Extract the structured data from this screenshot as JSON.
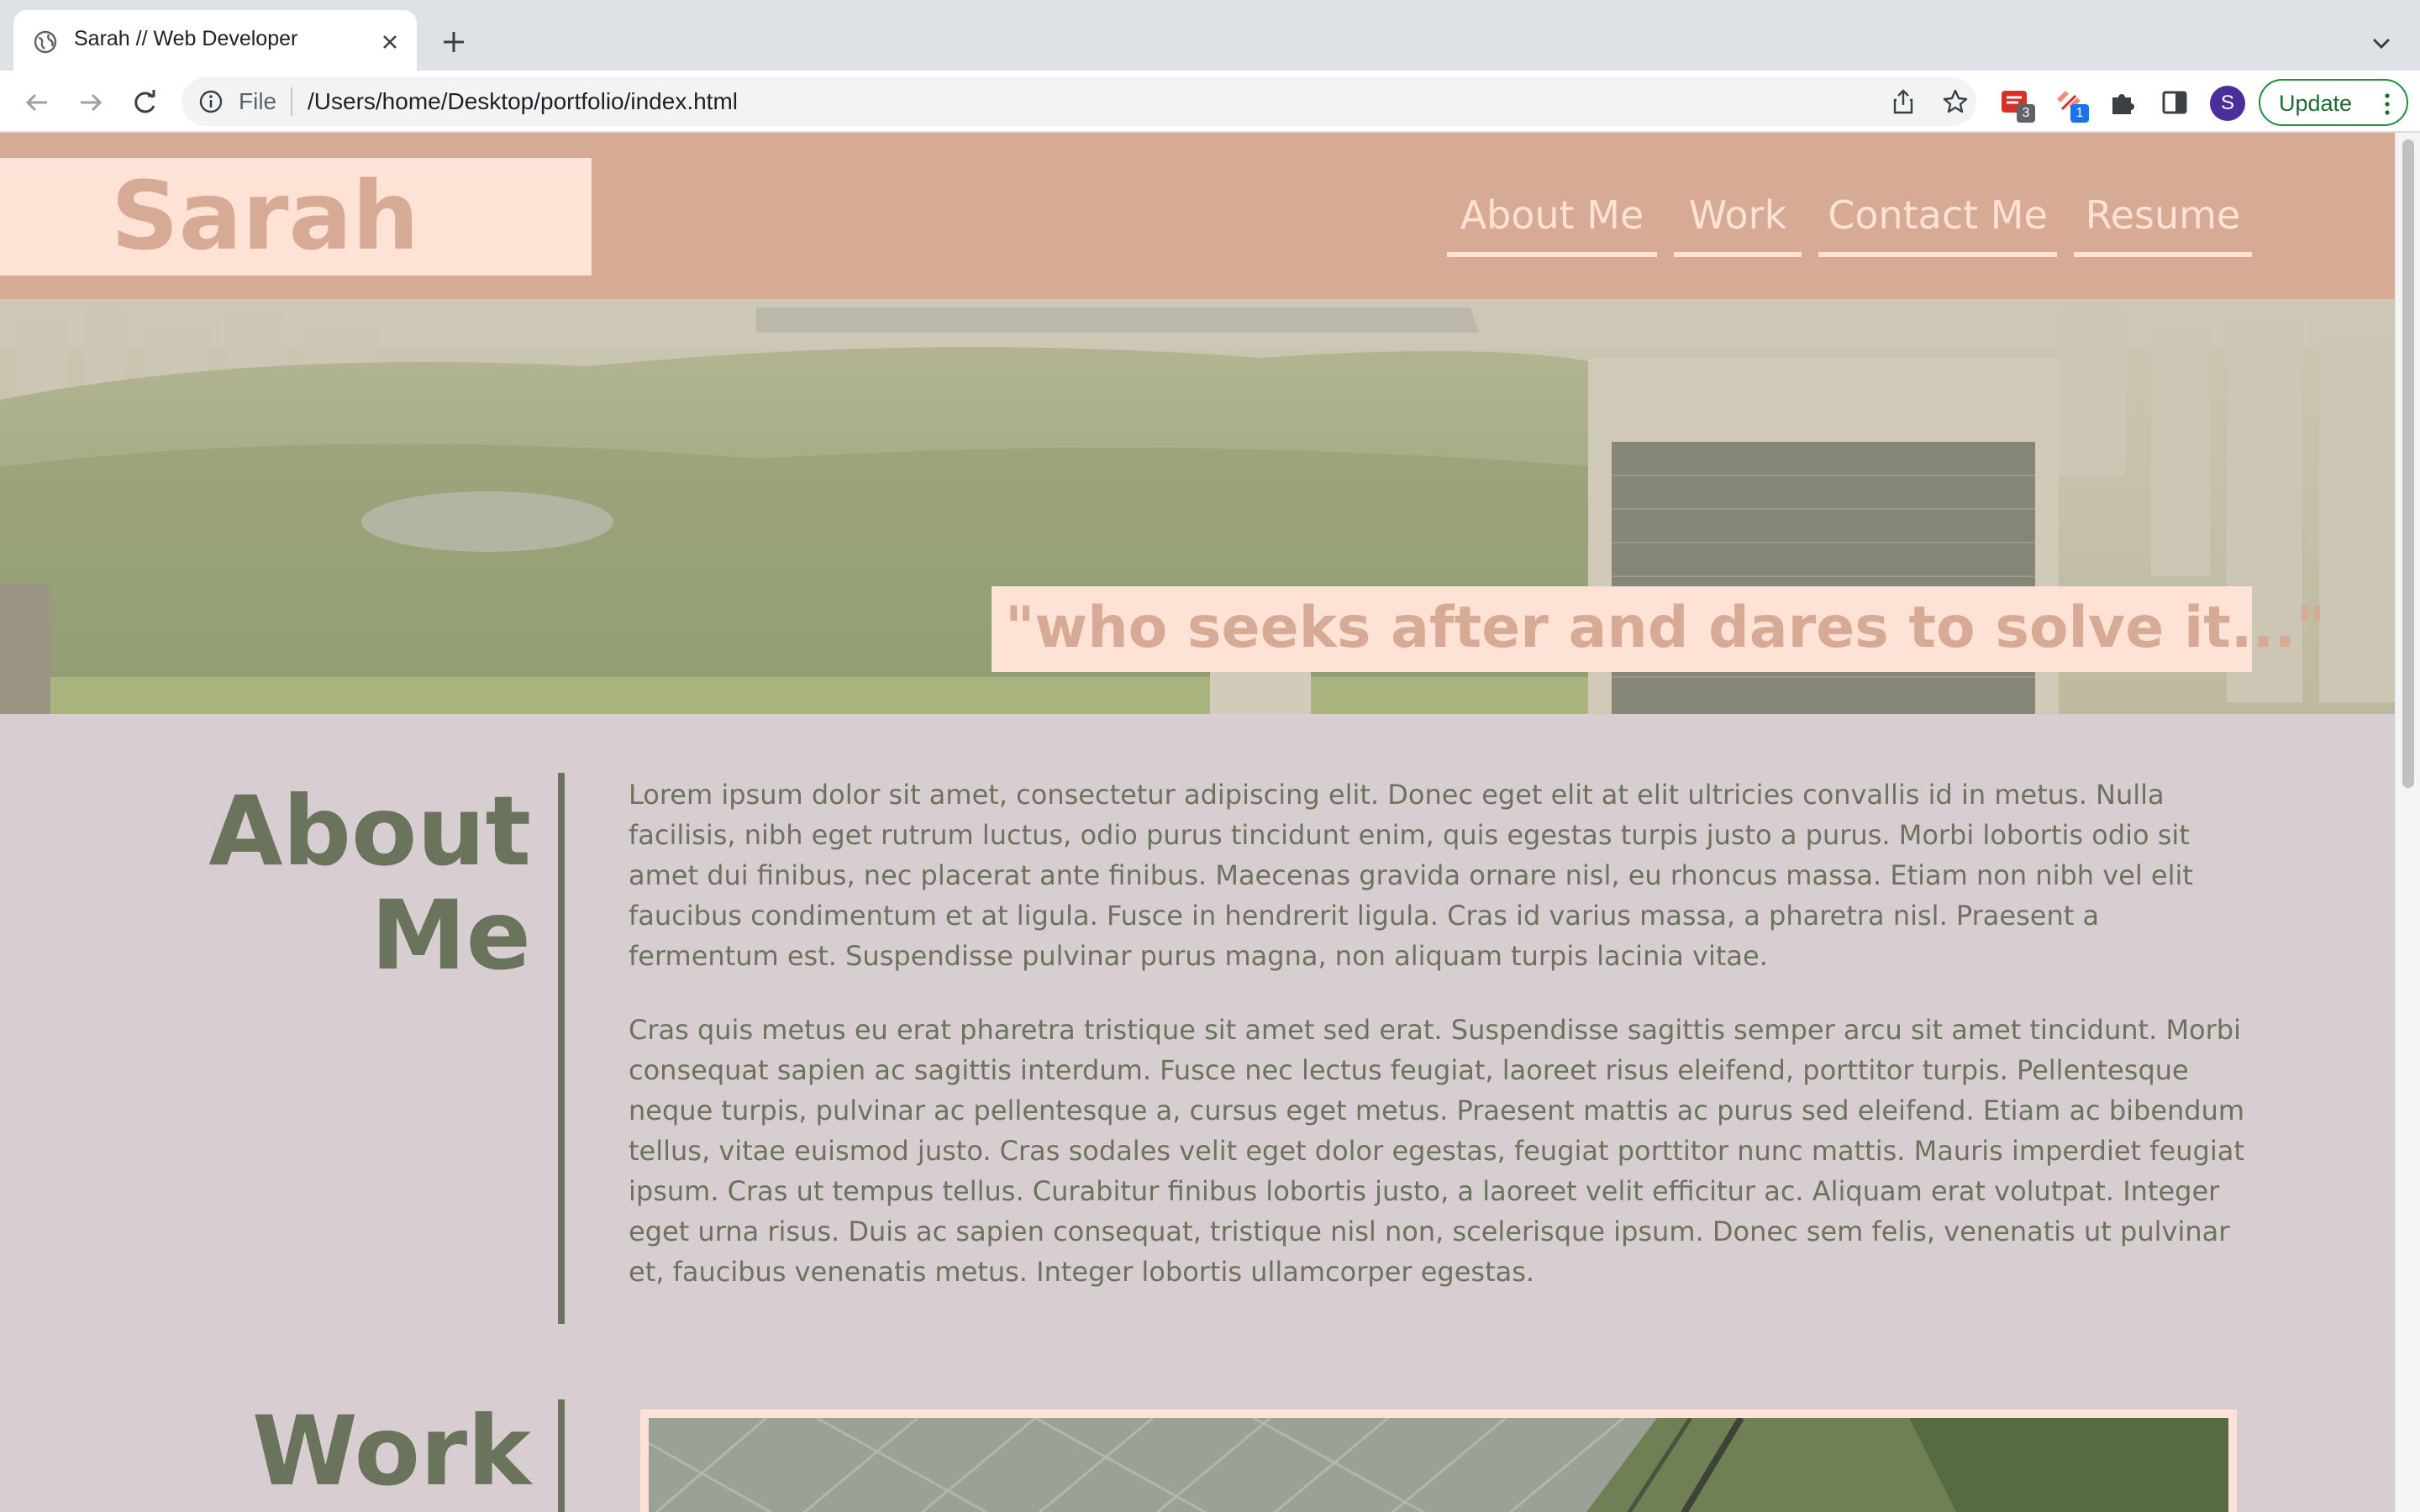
{
  "browser": {
    "tab_title": "Sarah // Web Developer",
    "omnibox_scheme": "File",
    "url": "/Users/home/Desktop/portfolio/index.html",
    "extensions": [
      {
        "name": "ext-red-icon",
        "badge": "3",
        "badge_color": "#5f6368"
      },
      {
        "name": "ext-pink-icon",
        "badge": "1",
        "badge_color": "#1a73e8"
      }
    ],
    "profile_initial": "S",
    "update_label": "Update"
  },
  "site": {
    "brand": "Sarah",
    "nav": [
      {
        "label": "About Me"
      },
      {
        "label": "Work"
      },
      {
        "label": "Contact Me"
      },
      {
        "label": "Resume"
      }
    ],
    "hero_quote": "\"who seeks after and dares to solve it...\"",
    "about": {
      "title_line1": "About",
      "title_line2": "Me",
      "paragraphs": [
        "Lorem ipsum dolor sit amet, consectetur adipiscing elit. Donec eget elit at elit ultricies convallis id in metus. Nulla facilisis, nibh eget rutrum luctus, odio purus tincidunt enim, quis egestas turpis justo a purus. Morbi lobortis odio sit amet dui finibus, nec placerat ante finibus. Maecenas gravida ornare nisl, eu rhoncus massa. Etiam non nibh vel elit faucibus condimentum et at ligula. Fusce in hendrerit ligula. Cras id varius massa, a pharetra nisl. Praesent a fermentum est. Suspendisse pulvinar purus magna, non aliquam turpis lacinia vitae.",
        "Cras quis metus eu erat pharetra tristique sit amet sed erat. Suspendisse sagittis semper arcu sit amet tincidunt. Morbi consequat sapien ac sagittis interdum. Fusce nec lectus feugiat, laoreet risus eleifend, porttitor turpis. Pellentesque neque turpis, pulvinar ac pellentesque a, cursus eget metus. Praesent mattis ac purus sed eleifend. Etiam ac bibendum tellus, vitae euismod justo. Cras sodales velit eget dolor egestas, feugiat porttitor nunc mattis. Mauris imperdiet feugiat ipsum. Cras ut tempus tellus. Curabitur finibus lobortis justo, a laoreet velit efficitur ac. Aliquam erat volutpat. Integer eget urna risus. Duis ac sapien consequat, tristique nisl non, scelerisque ipsum. Donec sem felis, venenatis ut pulvinar et, faucibus venenatis metus. Integer lobortis ullamcorper egestas."
      ]
    },
    "work": {
      "title": "Work"
    }
  },
  "colors": {
    "header_bg": "#d6aa95",
    "accent_light": "#fee2d5",
    "text_olive": "#6a735c",
    "page_bg": "#d8cdd0"
  }
}
